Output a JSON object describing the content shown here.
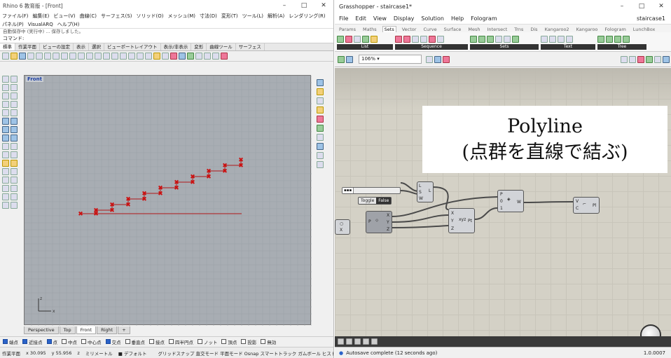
{
  "rhino": {
    "title": "Rhino 6 教育版 - [Front]",
    "menu": [
      "ファイル(F)",
      "編集(E)",
      "ビュー(V)",
      "曲線(C)",
      "サーフェス(S)",
      "ソリッド(O)",
      "メッシュ(M)",
      "寸法(D)",
      "変形(T)",
      "ツール(L)",
      "解析(A)",
      "レンダリング(R)",
      "パネル(P)",
      "VisualARQ",
      "ヘルプ(H)"
    ],
    "command_history": "自動保存中 (実行中) ... 保存しました。",
    "command_label": "コマンド:",
    "toolbar_tabs": [
      "標準",
      "作業平面",
      "ビューの設定",
      "表示",
      "選択",
      "ビューポートレイアウト",
      "表示/非表示",
      "変形",
      "曲線ツール",
      "サーフェス"
    ],
    "viewport_label": "Front",
    "viewport_tabs": [
      "Perspective",
      "Top",
      "Front",
      "Right",
      "+"
    ],
    "osnap": [
      {
        "label": "端点",
        "on": true
      },
      {
        "label": "近接点",
        "on": true
      },
      {
        "label": "点",
        "on": true
      },
      {
        "label": "中点",
        "on": false
      },
      {
        "label": "中心点",
        "on": false
      },
      {
        "label": "交点",
        "on": true
      },
      {
        "label": "垂直点",
        "on": false
      },
      {
        "label": "接点",
        "on": false
      },
      {
        "label": "四半円点",
        "on": false
      },
      {
        "label": "ノット",
        "on": false
      },
      {
        "label": "頂点",
        "on": false
      },
      {
        "label": "投影",
        "on": false
      },
      {
        "label": "無効",
        "on": false
      }
    ],
    "status": {
      "plane": "作業平面",
      "x": "x 30.095",
      "y": "y 55.956",
      "z": "z",
      "units": "ミリメートル",
      "layer": "デフォルト",
      "grid": "グリッドスナップ 直交モード 平面モード Osnap スマートトラック ガムボール ヒストリを記録"
    },
    "axis": {
      "x_label": "x",
      "y_label": "z"
    }
  },
  "grasshopper": {
    "title": "Grasshopper - staircase1*",
    "menu": [
      "File",
      "Edit",
      "View",
      "Display",
      "Solution",
      "Help",
      "Fologram"
    ],
    "document": "staircase1",
    "tabs": [
      "Params",
      "Maths",
      "Sets",
      "Vector",
      "Curve",
      "Surface",
      "Mesh",
      "Intersect",
      "Trns",
      "Dis",
      "Kangaroo2",
      "Kangaroo",
      "Fologram",
      "LunchBox"
    ],
    "active_tab": "Sets",
    "ribbon_groups": [
      "List",
      "Sequence",
      "Sets",
      "Text",
      "Tree"
    ],
    "zoom": "106%",
    "panel": {
      "line1": "Polyline",
      "line2": "(点群を直線で結ぶ)"
    },
    "toggle": {
      "label": "Toggle",
      "value": "False"
    },
    "status": "Autosave complete (12 seconds ago)",
    "version": "1.0.0007"
  },
  "colors": {
    "accent": "#2b63c9",
    "point": "#cc1111",
    "line": "#b01818"
  }
}
